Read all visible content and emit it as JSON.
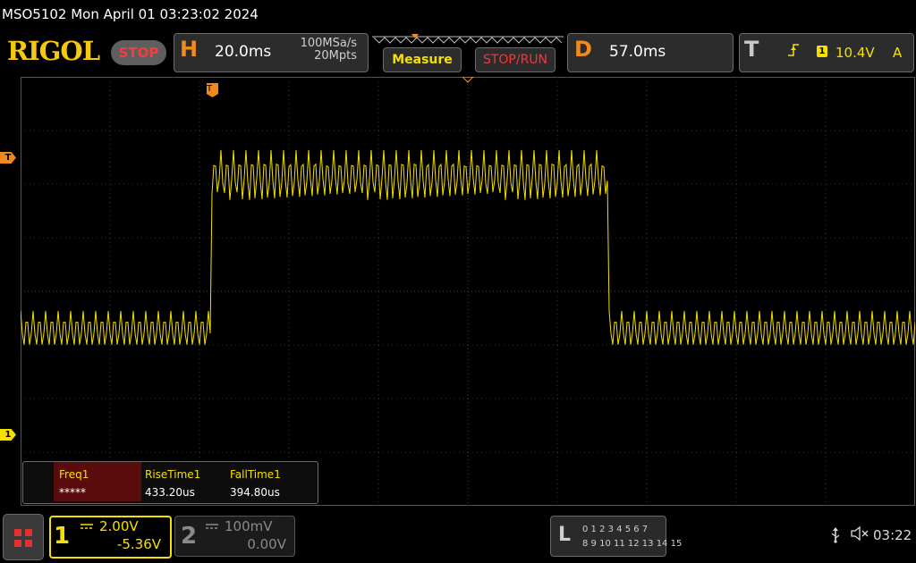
{
  "title_bar": {
    "text": "MSO5102  Mon April 01 03:23:02 2024"
  },
  "brand": {
    "logo": "RIGOL",
    "run_state": "STOP"
  },
  "horizontal": {
    "letter": "H",
    "timebase": "20.0ms",
    "sample_rate": "100MSa/s",
    "memory_depth": "20Mpts"
  },
  "buttons": {
    "measure": "Measure",
    "stop_run": "STOP/RUN"
  },
  "delay": {
    "letter": "D",
    "value": "57.0ms"
  },
  "trigger": {
    "letter": "T",
    "source": "1",
    "level": "10.4V",
    "mode": "A",
    "slope_icon": "rising-edge-icon"
  },
  "markers": {
    "trigger_level": "T",
    "channel1_ground": "1",
    "trigger_position": "T"
  },
  "measurements": [
    {
      "name": "Freq1",
      "value": "*****"
    },
    {
      "name": "RiseTime1",
      "value": "433.20us"
    },
    {
      "name": "FallTime1",
      "value": "394.80us"
    }
  ],
  "channel1": {
    "number": "1",
    "scale": "2.00V",
    "offset": "-5.36V"
  },
  "channel2": {
    "number": "2",
    "scale": "100mV",
    "offset": "0.00V"
  },
  "logic": {
    "letter": "L",
    "row1": "0 1 2 3   4 5 6 7",
    "row2": "8  9 10 11  12 13 14 15"
  },
  "status": {
    "clock": "03:22",
    "usb_icon": "usb-icon",
    "speaker_icon": "speaker-muted-icon"
  },
  "colors": {
    "ch1": "#f6e000",
    "trigger": "#f08a1c",
    "grid": "#3a3a3a",
    "stop": "#f04040"
  }
}
